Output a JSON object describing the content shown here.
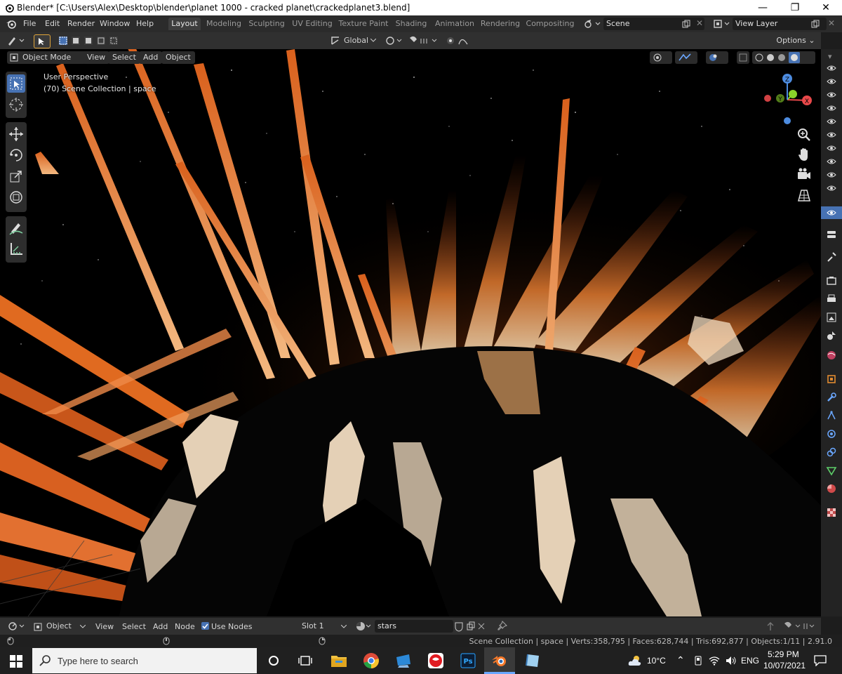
{
  "window": {
    "title": "Blender* [C:\\Users\\Alex\\Desktop\\blender\\planet 1000 - cracked planet\\crackedplanet3.blend]",
    "minimize": "—",
    "maximize": "❐",
    "close": "✕"
  },
  "menus": [
    "File",
    "Edit",
    "Render",
    "Window",
    "Help"
  ],
  "workspaces": [
    "Layout",
    "Modeling",
    "Sculpting",
    "UV Editing",
    "Texture Paint",
    "Shading",
    "Animation",
    "Rendering",
    "Compositing"
  ],
  "scene": {
    "name": "Scene",
    "view_layer": "View Layer"
  },
  "tool_header": {
    "orientation": "Global",
    "options": "Options"
  },
  "viewport": {
    "mode": "Object Mode",
    "menus": [
      "View",
      "Select",
      "Add",
      "Object"
    ],
    "perspective": "User Perspective",
    "collection_info": "(70) Scene Collection | space",
    "gizmo_axes": {
      "x": "X",
      "y": "Y",
      "z": "Z"
    }
  },
  "shader_editor": {
    "type": "Object",
    "menus": [
      "View",
      "Select",
      "Add",
      "Node"
    ],
    "use_nodes_label": "Use Nodes",
    "use_nodes_checked": true,
    "slot": "Slot 1",
    "material": "stars"
  },
  "statusbar": {
    "stats": "Scene Collection | space | Verts:358,795 | Faces:628,744 | Tris:692,877 | Objects:1/11 | 2.91.0"
  },
  "taskbar": {
    "search_placeholder": "Type here to search",
    "weather": "10°C",
    "language": "ENG",
    "time": "5:29 PM",
    "date": "10/07/2021",
    "apps": [
      "task-view",
      "file-explorer",
      "chrome",
      "app-blue",
      "app-red",
      "photoshop",
      "blender",
      "app-book"
    ]
  },
  "colors": {
    "accent": "#4772b3",
    "ray_orange": "#e06a20",
    "ray_light": "#f6cfa0",
    "axis_x": "#e8484a",
    "axis_y": "#8ad22a",
    "axis_z": "#4d8ce0"
  }
}
